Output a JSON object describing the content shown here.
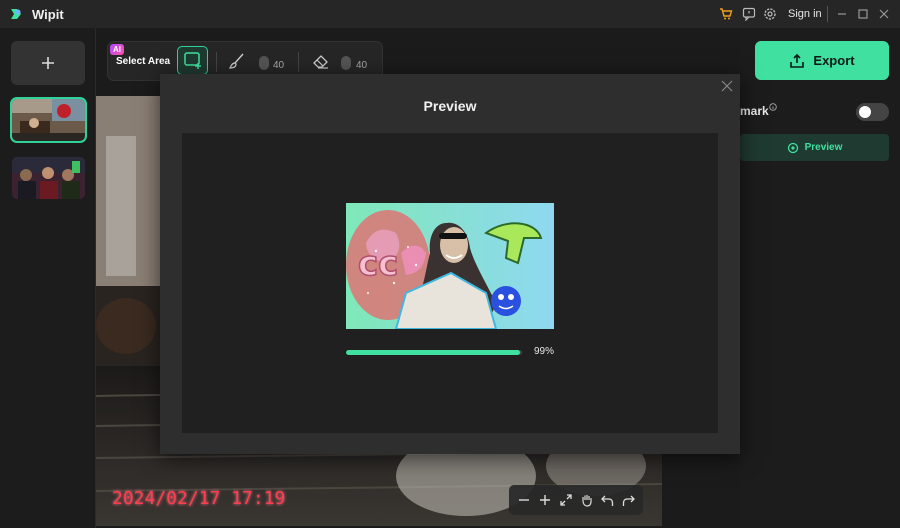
{
  "app": {
    "title": "Wipit"
  },
  "titlebar": {
    "sign_in": "Sign in"
  },
  "toolbar": {
    "ai_badge": "AI",
    "select_area": "Select Area",
    "brush_size": "40",
    "eraser_size": "40"
  },
  "canvas": {
    "timestamp": "2024/02/17 17:19"
  },
  "right_panel": {
    "export_label": "Export",
    "watermark_label": "mark",
    "watermark_on": false,
    "preview_label": "Preview"
  },
  "modal": {
    "title": "Preview",
    "progress": 0.99,
    "progress_text": "99%"
  },
  "colors": {
    "accent": "#3fe0a0",
    "timestamp": "#ff3d4f"
  },
  "icons": [
    "logo-icon",
    "cart-icon",
    "feedback-icon",
    "settings-icon",
    "minimize-icon",
    "maximize-icon",
    "close-icon",
    "plus-icon",
    "select-area-icon",
    "brush-icon",
    "eraser-icon",
    "zoom-out-icon",
    "zoom-in-icon",
    "fit-icon",
    "hand-icon",
    "undo-icon",
    "redo-icon",
    "export-icon",
    "eye-icon"
  ]
}
